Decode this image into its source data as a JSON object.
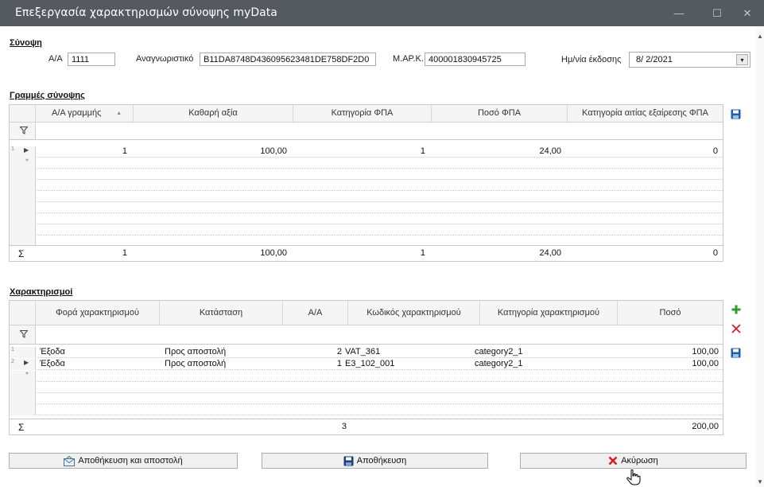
{
  "window": {
    "title": "Επεξεργασία χαρακτηρισμών σύνοψης myData",
    "minimize": "—",
    "maximize": "☐",
    "close": "✕"
  },
  "summary": {
    "section": "Σύνοψη",
    "aa_label": "Α/Α",
    "aa_value": "1111",
    "id_label": "Αναγνωριστικό",
    "id_value": "B11DA8748D436095623481DE758DF2D0",
    "mark_label": "Μ.ΑΡ.Κ.",
    "mark_value": "400001830945725",
    "date_label": "Ημ/νία έκδοσης",
    "date_value": "8/ 2/2021",
    "date_dropdown_icon": "▾"
  },
  "lines": {
    "section": "Γραμμές σύνοψης",
    "columns": [
      "Α/Α γραμμής",
      "Καθαρή αξία",
      "Κατηγορία ΦΠΑ",
      "Ποσό ΦΠΑ",
      "Κατηγορία αιτίας εξαίρεσης ΦΠΑ"
    ],
    "sort_indicator": "▲",
    "rows": [
      {
        "num": "1",
        "aa": "1",
        "net": "100,00",
        "vat_cat": "1",
        "vat_amount": "24,00",
        "exempt": "0"
      }
    ],
    "new_row_marker": "*",
    "totals": {
      "sigma": "Σ",
      "aa": "1",
      "net": "100,00",
      "vat_cat": "1",
      "vat_amount": "24,00",
      "exempt": "0"
    }
  },
  "chars": {
    "section": "Χαρακτηρισμοί",
    "columns": [
      "Φορά χαρακτηρισμού",
      "Κατάσταση",
      "Α/Α",
      "Κωδικός χαρακτηρισμού",
      "Κατηγορία χαρακτηρισμού",
      "Ποσό"
    ],
    "rows": [
      {
        "num": "1",
        "direction": "Έξοδα",
        "status": "Προς αποστολή",
        "aa": "2",
        "code": "VAT_361",
        "category": "category2_1",
        "amount": "100,00"
      },
      {
        "num": "2",
        "direction": "Έξοδα",
        "status": "Προς αποστολή",
        "aa": "1",
        "code": "E3_102_001",
        "category": "category2_1",
        "amount": "100,00"
      }
    ],
    "new_row_marker": "*",
    "totals": {
      "sigma": "Σ",
      "aa": "3",
      "amount": "200,00"
    }
  },
  "buttons": {
    "save_send": "Αποθήκευση και αποστολή",
    "save": "Αποθήκευση",
    "cancel": "Ακύρωση"
  },
  "colors": {
    "titlebar": "#555a60",
    "save_icon": "#1e5fa8",
    "add_icon": "#2e9e2e",
    "delete_icon": "#d62020"
  }
}
